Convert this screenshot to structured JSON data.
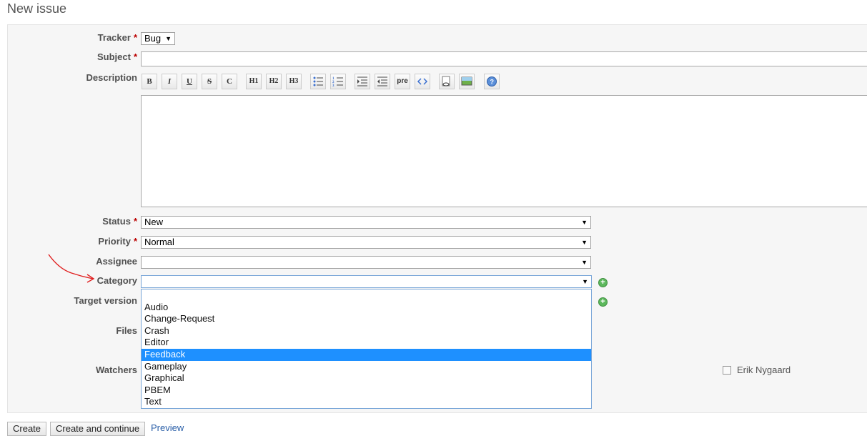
{
  "page_title": "New issue",
  "form": {
    "tracker": {
      "label": "Tracker",
      "required_mark": "*",
      "value": "Bug"
    },
    "subject": {
      "label": "Subject",
      "required_mark": "*",
      "value": ""
    },
    "description": {
      "label": "Description",
      "value": ""
    },
    "toolbar": {
      "bold": "B",
      "italic": "I",
      "underline": "U",
      "strike": "S",
      "code": "C",
      "h1": "H1",
      "h2": "H2",
      "h3": "H3",
      "pre": "pre"
    },
    "status": {
      "label": "Status",
      "required_mark": "*",
      "value": "New"
    },
    "priority": {
      "label": "Priority",
      "required_mark": "*",
      "value": "Normal"
    },
    "assignee": {
      "label": "Assignee",
      "value": ""
    },
    "category": {
      "label": "Category",
      "value": ""
    },
    "target_version": {
      "label": "Target version"
    },
    "files": {
      "label": "Files"
    },
    "watchers": {
      "label": "Watchers",
      "items": [
        {
          "name": "Erik Nygaard",
          "checked": false
        }
      ]
    }
  },
  "category_dropdown": {
    "options": [
      "",
      "Audio",
      "Change-Request",
      "Crash",
      "Editor",
      "Feedback",
      "Gameplay",
      "Graphical",
      "PBEM",
      "Text"
    ],
    "highlighted": "Feedback"
  },
  "buttons": {
    "create": "Create",
    "create_continue": "Create and continue",
    "preview": "Preview"
  },
  "colors": {
    "accent_link": "#2a5fa8",
    "required": "#bb0000",
    "highlight": "#1e90ff",
    "annotation_arrow": "#e02020"
  }
}
